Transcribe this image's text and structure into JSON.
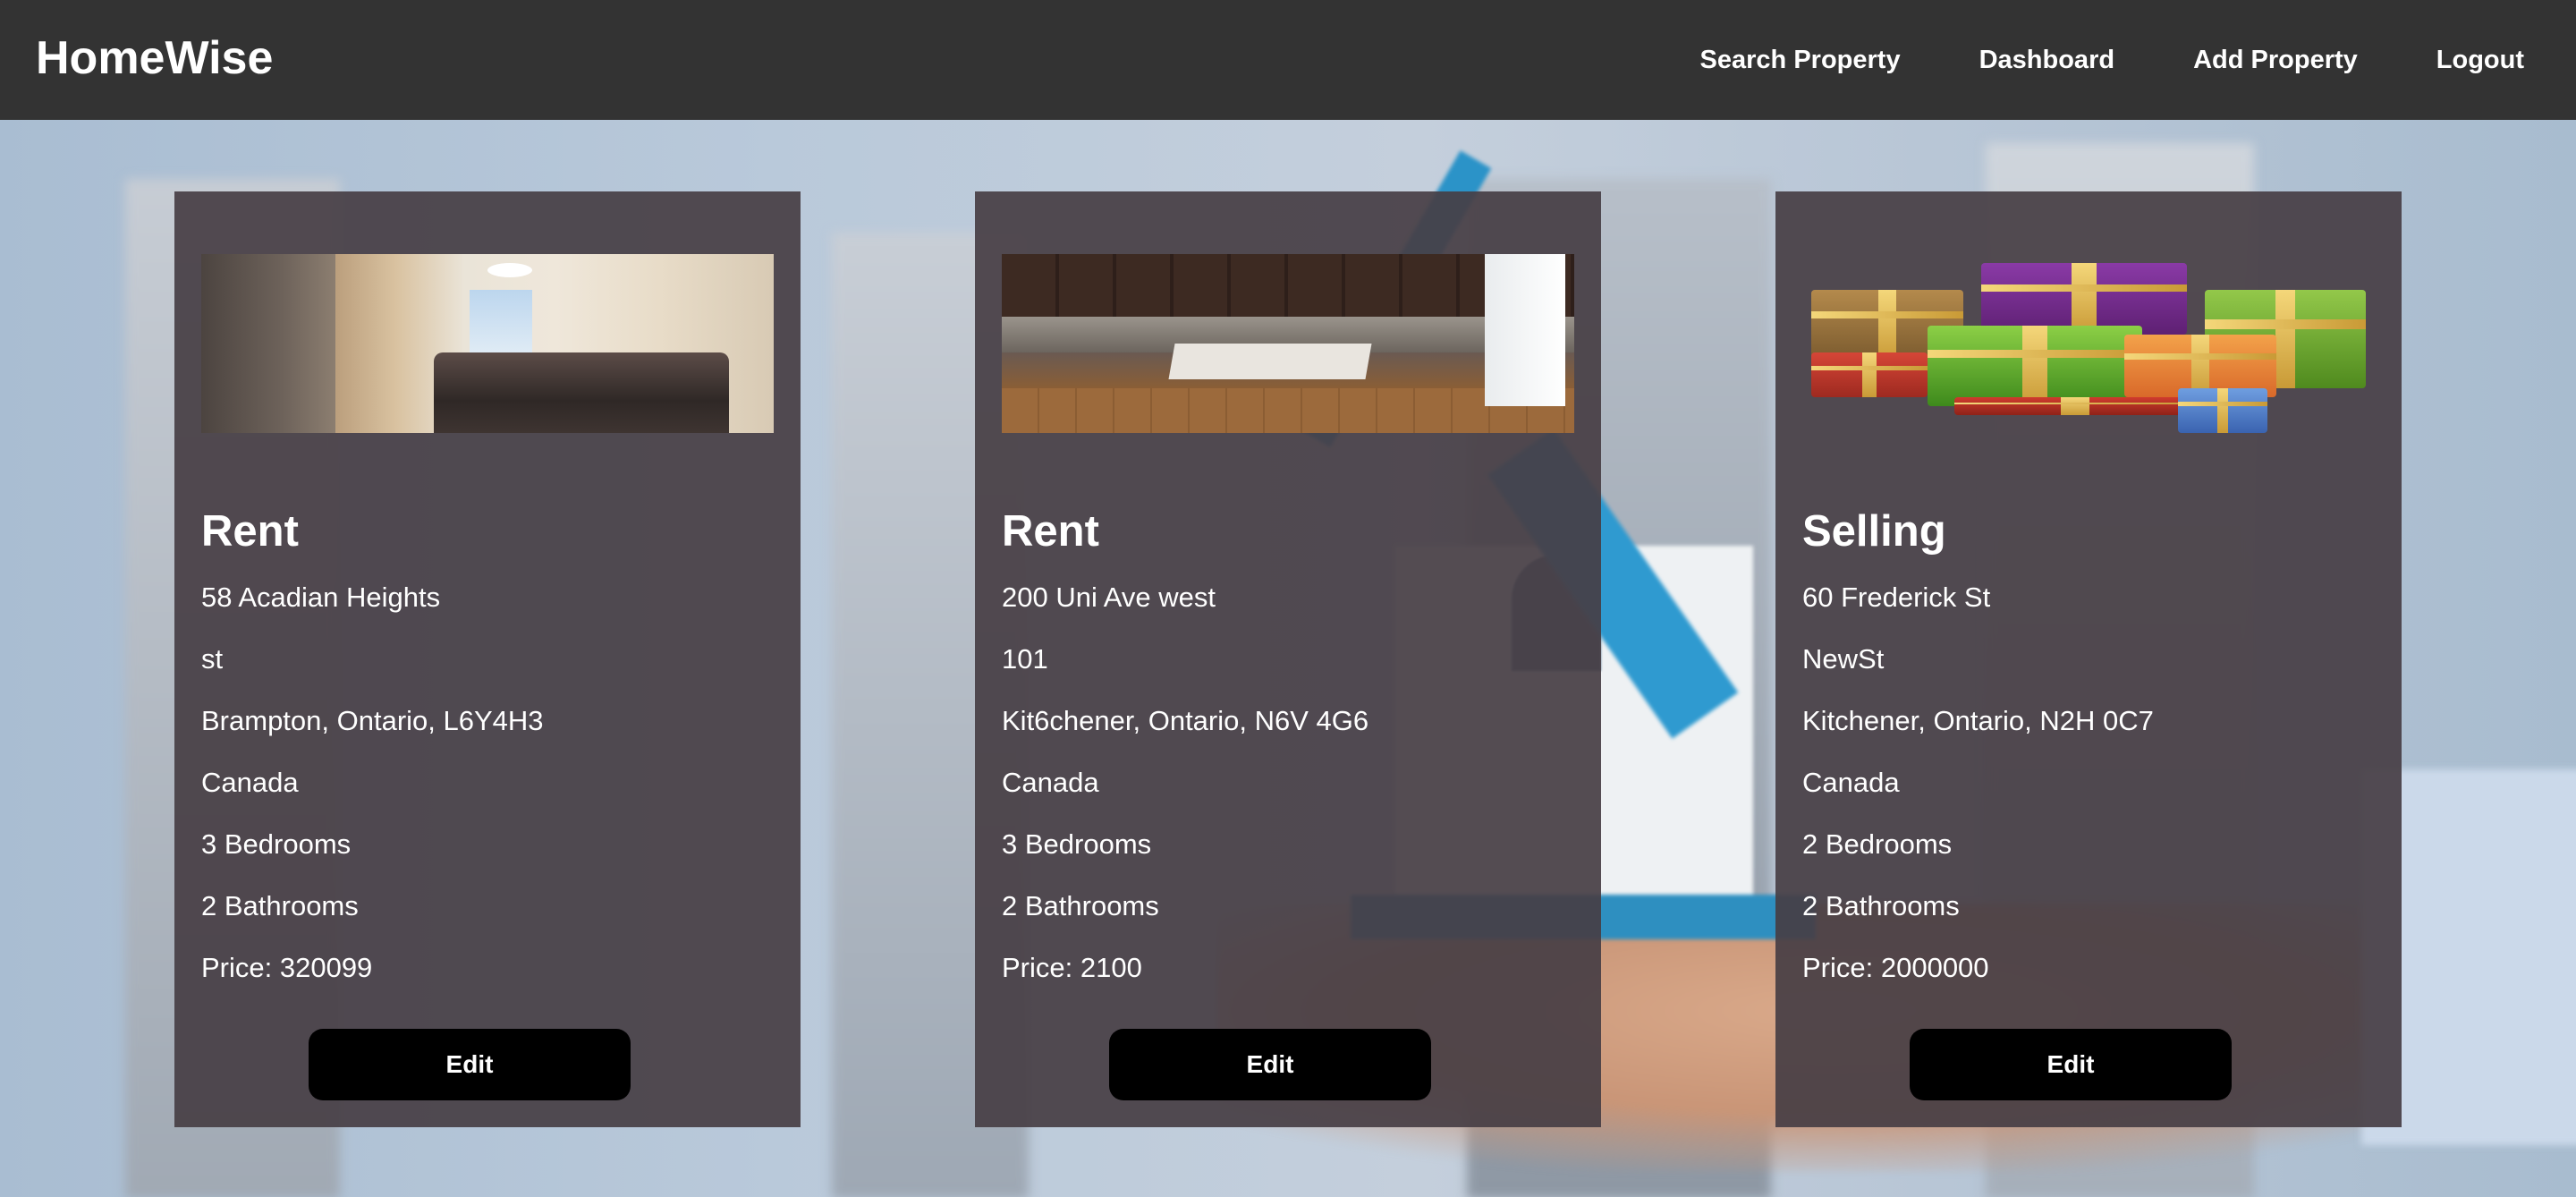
{
  "navbar": {
    "brand": "HomeWise",
    "links": [
      "Search Property",
      "Dashboard",
      "Add Property",
      "Logout"
    ]
  },
  "cards": [
    {
      "image": "bedroom-photo",
      "type": "Rent",
      "address_line1": "58 Acadian Heights",
      "address_line2": "st",
      "city_line": "Brampton, Ontario, L6Y4H3",
      "country": "Canada",
      "bedrooms": "3 Bedrooms",
      "bathrooms": "2 Bathrooms",
      "price": "Price: 320099",
      "edit_label": "Edit"
    },
    {
      "image": "kitchen-photo",
      "type": "Rent",
      "address_line1": "200 Uni Ave west",
      "address_line2": "101",
      "city_line": "Kit6chener, Ontario, N6V 4G6",
      "country": "Canada",
      "bedrooms": "3 Bedrooms",
      "bathrooms": "2 Bathrooms",
      "price": "Price: 2100",
      "edit_label": "Edit"
    },
    {
      "image": "gift-boxes-photo",
      "type": "Selling",
      "address_line1": "60 Frederick St",
      "address_line2": "NewSt",
      "city_line": "Kitchener, Ontario, N2H 0C7",
      "country": "Canada",
      "bedrooms": "2 Bedrooms",
      "bathrooms": "2 Bathrooms",
      "price": "Price: 2000000",
      "edit_label": "Edit"
    }
  ],
  "colors": {
    "navbar_bg": "#333333",
    "card_bg": "#463e44",
    "button_bg": "#000000",
    "text": "#ffffff"
  }
}
